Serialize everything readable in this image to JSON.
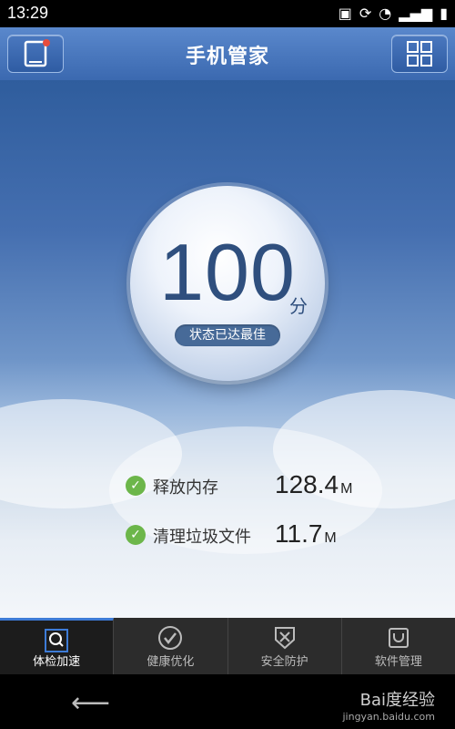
{
  "status_bar": {
    "time": "13:29"
  },
  "header": {
    "title": "手机管家"
  },
  "main": {
    "score": "100",
    "score_unit": "分",
    "status_badge": "状态已达最佳",
    "stats": [
      {
        "label": "释放内存",
        "value": "128.4",
        "unit": "M"
      },
      {
        "label": "清理垃圾文件",
        "value": "11.7",
        "unit": "M"
      }
    ]
  },
  "tabs": [
    {
      "label": "体检加速",
      "icon": "magnifier-icon",
      "active": true
    },
    {
      "label": "健康优化",
      "icon": "check-circle-icon",
      "active": false
    },
    {
      "label": "安全防护",
      "icon": "shield-x-icon",
      "active": false
    },
    {
      "label": "软件管理",
      "icon": "bag-icon",
      "active": false
    }
  ],
  "watermark": {
    "main": "Bai度经验",
    "sub": "jingyan.baidu.com"
  },
  "colors": {
    "accent": "#3d7bd6",
    "check": "#6cb64a",
    "header": "#4a78bf"
  }
}
